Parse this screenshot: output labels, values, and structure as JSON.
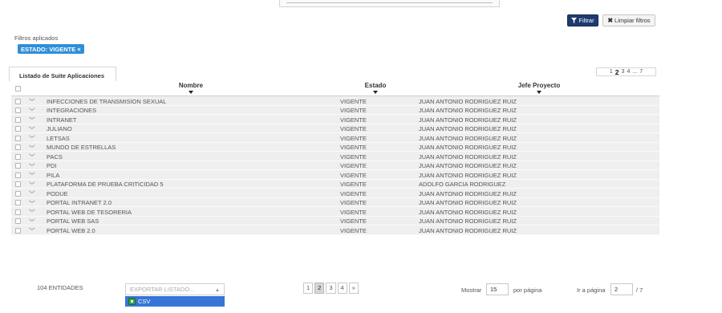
{
  "toolbar": {
    "filtrar_label": "Filtrar",
    "limpiar_label": "Limpiar filtros"
  },
  "filters": {
    "title": "Filtros aplicados",
    "chips": [
      {
        "label": "ESTADO: VIGENTE",
        "remove": "×"
      }
    ]
  },
  "tab": {
    "label": "Listado de Suite Aplicaciones"
  },
  "pager_top": {
    "pages": [
      "1",
      "2",
      "3",
      "4",
      "...",
      "7"
    ],
    "current": "2"
  },
  "table": {
    "columns": [
      "Nombre",
      "Estado",
      "Jefe Proyecto"
    ],
    "rows": [
      [
        "INFECCIONES DE TRANSMISION SEXUAL",
        "VIGENTE",
        "JUAN ANTONIO RODRIGUEZ RUIZ"
      ],
      [
        "INTEGRACIONES",
        "VIGENTE",
        "JUAN ANTONIO RODRIGUEZ RUIZ"
      ],
      [
        "INTRANET",
        "VIGENTE",
        "JUAN ANTONIO RODRIGUEZ RUIZ"
      ],
      [
        "JULIANO",
        "VIGENTE",
        "JUAN ANTONIO RODRIGUEZ RUIZ"
      ],
      [
        "LETSAS",
        "VIGENTE",
        "JUAN ANTONIO RODRIGUEZ RUIZ"
      ],
      [
        "MUNDO DE ESTRELLAS",
        "VIGENTE",
        "JUAN ANTONIO RODRIGUEZ RUIZ"
      ],
      [
        "PACS",
        "VIGENTE",
        "JUAN ANTONIO RODRIGUEZ RUIZ"
      ],
      [
        "PDI",
        "VIGENTE",
        "JUAN ANTONIO RODRIGUEZ RUIZ"
      ],
      [
        "PILA",
        "VIGENTE",
        "JUAN ANTONIO RODRIGUEZ RUIZ"
      ],
      [
        "PLATAFORMA DE PRUEBA CRITICIDAD 5",
        "VIGENTE",
        "ADOLFO GARCIA RODRIGUEZ"
      ],
      [
        "PODUE",
        "VIGENTE",
        "JUAN ANTONIO RODRIGUEZ RUIZ"
      ],
      [
        "PORTAL INTRANET 2.0",
        "VIGENTE",
        "JUAN ANTONIO RODRIGUEZ RUIZ"
      ],
      [
        "PORTAL WEB DE TESORERIA",
        "VIGENTE",
        "JUAN ANTONIO RODRIGUEZ RUIZ"
      ],
      [
        "PORTAL WEB SAS",
        "VIGENTE",
        "JUAN ANTONIO RODRIGUEZ RUIZ"
      ],
      [
        "PORTAL WEB 2.0",
        "VIGENTE",
        "JUAN ANTONIO RODRIGUEZ RUIZ"
      ]
    ]
  },
  "footer": {
    "entities": "104 ENTIDADES",
    "export_placeholder": "EXPORTAR LISTADO...",
    "export_option": "CSV",
    "pages": [
      "1",
      "2",
      "3",
      "4",
      "»"
    ],
    "current_page": "2",
    "mostrar_label": "Mostrar",
    "per_page_value": "15",
    "por_pagina_label": "por página",
    "ir_a_label": "Ir a página",
    "goto_value": "2",
    "total_pages": "/ 7"
  },
  "colors": {
    "filtrar_bg": "#1f3a6f",
    "chip_bg": "#2f8fd8",
    "row_bg": "#efefef",
    "export_highlight": "#3875d7"
  },
  "icons": [
    "filter-icon",
    "close-x-icon",
    "sort-down-icon",
    "chevron-down-icon",
    "csv-file-icon"
  ]
}
